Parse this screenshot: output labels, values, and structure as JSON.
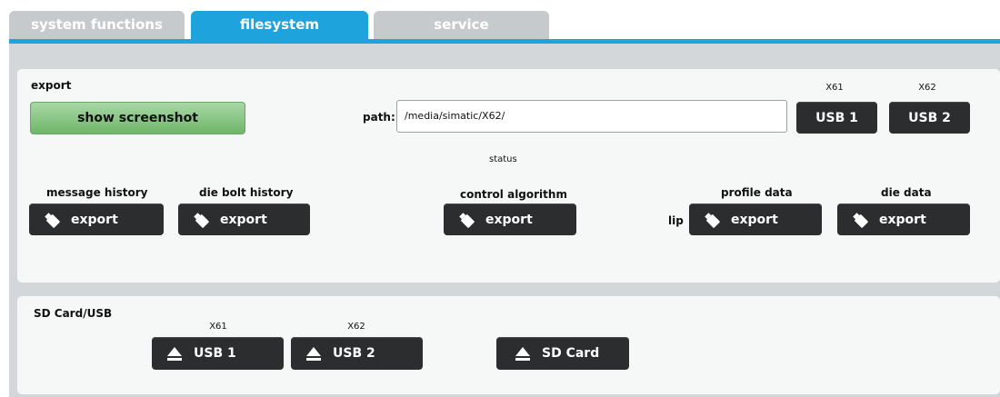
{
  "tabs": [
    {
      "label": "system functions",
      "active": false
    },
    {
      "label": "filesystem",
      "active": true
    },
    {
      "label": "service",
      "active": false
    }
  ],
  "export": {
    "title": "export",
    "show_screenshot": "show screenshot",
    "path_label": "path:",
    "path_value": "/media/simatic/X62/",
    "status_label": "status",
    "usb_top": [
      {
        "port": "X61",
        "label": "USB 1"
      },
      {
        "port": "X62",
        "label": "USB 2"
      }
    ],
    "groups": [
      {
        "title": "message history",
        "button": "export"
      },
      {
        "title": "die bolt history",
        "button": "export"
      },
      {
        "title": "control algorithm",
        "button": "export"
      },
      {
        "title": "profile data",
        "prefix": "lip",
        "button": "export"
      },
      {
        "title": "die data",
        "button": "export"
      }
    ]
  },
  "sdcard": {
    "title": "SD Card/USB",
    "buttons": [
      {
        "port": "X61",
        "label": "USB 1"
      },
      {
        "port": "X62",
        "label": "USB 2"
      },
      {
        "port": "",
        "label": "SD Card"
      }
    ]
  },
  "colors": {
    "accent": "#1ea3dc",
    "button": "#2b2d2f",
    "green": "#7fc27a",
    "panel": "#f6f7f7",
    "background": "#d4d7d9"
  },
  "icons": {
    "export_icon": "usb-stick-icon",
    "eject_icon": "eject-icon"
  }
}
